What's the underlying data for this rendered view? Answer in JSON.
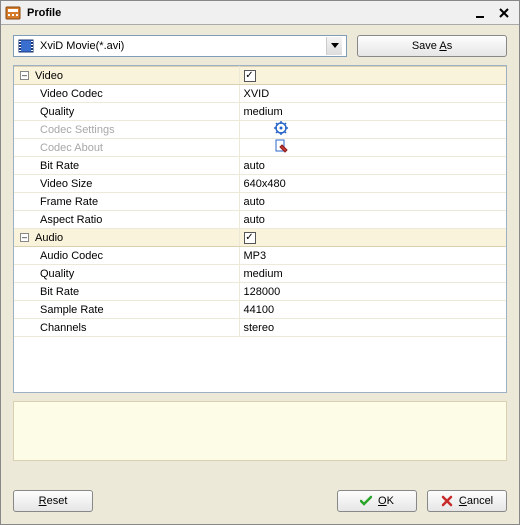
{
  "window": {
    "title": "Profile"
  },
  "toolbar": {
    "profile_selected": "XviD Movie(*.avi)",
    "saveas_label_pre": "Save ",
    "saveas_label_u": "A",
    "saveas_label_post": "s"
  },
  "sections": {
    "video": {
      "header": "Video",
      "enabled": "✓",
      "rows": {
        "video_codec": {
          "label": "Video Codec",
          "value": "XVID"
        },
        "quality": {
          "label": "Quality",
          "value": "medium"
        },
        "codec_settings": {
          "label": "Codec Settings"
        },
        "codec_about": {
          "label": "Codec About"
        },
        "bit_rate": {
          "label": "Bit Rate",
          "value": "auto"
        },
        "video_size": {
          "label": "Video Size",
          "value": "640x480"
        },
        "frame_rate": {
          "label": "Frame Rate",
          "value": "auto"
        },
        "aspect_ratio": {
          "label": "Aspect Ratio",
          "value": "auto"
        }
      }
    },
    "audio": {
      "header": "Audio",
      "enabled": "✓",
      "rows": {
        "audio_codec": {
          "label": "Audio Codec",
          "value": "MP3"
        },
        "quality": {
          "label": "Quality",
          "value": "medium"
        },
        "bit_rate": {
          "label": "Bit Rate",
          "value": "128000"
        },
        "sample_rate": {
          "label": "Sample Rate",
          "value": "44100"
        },
        "channels": {
          "label": "Channels",
          "value": "stereo"
        }
      }
    }
  },
  "footer": {
    "reset_u": "R",
    "reset_post": "eset",
    "ok_u": "O",
    "ok_post": "K",
    "cancel_u": "C",
    "cancel_post": "ancel"
  }
}
